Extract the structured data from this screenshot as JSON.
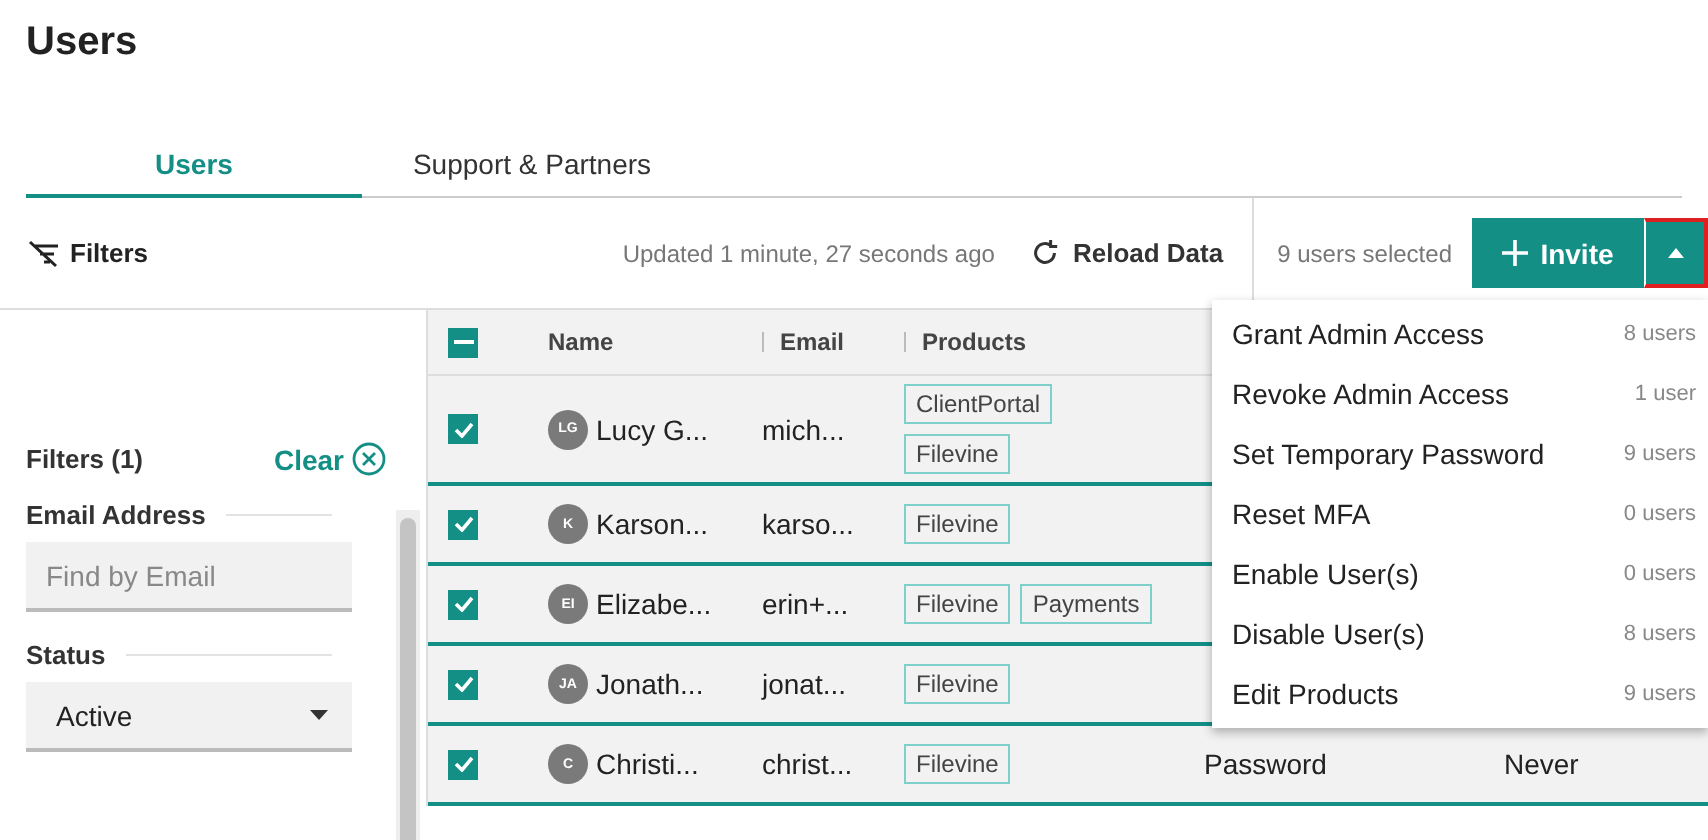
{
  "page_title": "Users",
  "tabs": [
    {
      "label": "Users",
      "selected": true
    },
    {
      "label": "Support & Partners",
      "selected": false
    }
  ],
  "toolbar": {
    "filters_label": "Filters",
    "updated": "Updated 1 minute, 27 seconds ago",
    "reload_label": "Reload Data",
    "selection_count": "9 users selected",
    "invite_label": "Invite",
    "menu_expanded": true
  },
  "sidebar": {
    "heading": "Filters (1)",
    "clear_label": "Clear",
    "sections": [
      {
        "kind": "text",
        "label": "Email Address",
        "placeholder": "Find by Email"
      },
      {
        "kind": "select",
        "label": "Status",
        "value": "Active"
      }
    ]
  },
  "table": {
    "select_all_indeterminate": true,
    "columns": [
      "Name",
      "Email",
      "Products"
    ],
    "rows": [
      {
        "checked": true,
        "initials": "LG",
        "name": "Lucy G...",
        "email": "mich...",
        "products": [
          "ClientPortal",
          "Filevine"
        ]
      },
      {
        "checked": true,
        "initials": "K",
        "name": "Karson...",
        "email": "karso...",
        "products": [
          "Filevine"
        ]
      },
      {
        "checked": true,
        "initials": "EI",
        "name": "Elizabe...",
        "email": "erin+...",
        "products": [
          "Filevine",
          "Payments"
        ]
      },
      {
        "checked": true,
        "initials": "JA",
        "name": "Jonath...",
        "email": "jonat...",
        "products": [
          "Filevine"
        ]
      },
      {
        "checked": true,
        "initials": "C",
        "name": "Christi...",
        "email": "christ...",
        "products": [
          "Filevine"
        ],
        "column_4": "Password",
        "column_5": "Never"
      }
    ]
  },
  "menu": [
    {
      "label": "Grant Admin Access",
      "count": "8 users"
    },
    {
      "label": "Revoke Admin Access",
      "count": "1 user"
    },
    {
      "label": "Set Temporary Password",
      "count": "9 users"
    },
    {
      "label": "Reset MFA",
      "count": "0 users"
    },
    {
      "label": "Enable User(s)",
      "count": "0 users"
    },
    {
      "label": "Disable User(s)",
      "count": "8 users"
    },
    {
      "label": "Edit Products",
      "count": "9 users"
    }
  ]
}
